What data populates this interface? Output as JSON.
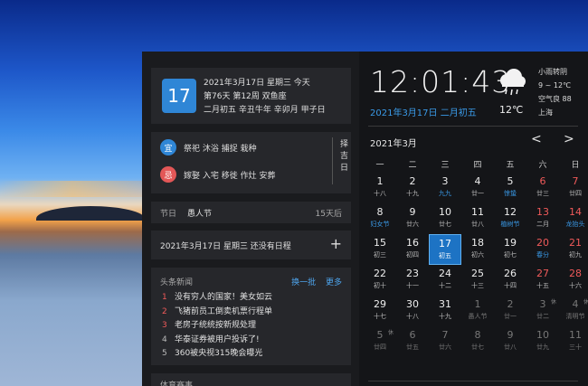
{
  "date_card": {
    "day": "17",
    "line1": "2021年3月17日 星期三 今天",
    "line2": "第76天 第12周 双鱼座",
    "line3": "二月初五 辛丑牛年 辛卯月 甲子日"
  },
  "yiji": {
    "yi_label": "宜",
    "yi_text": "祭祀 沐浴 捕捉 栽种",
    "ji_label": "忌",
    "ji_text": "嫁娶 入宅 移徙 作灶 安葬",
    "zeji_label": "择吉日"
  },
  "festival": {
    "label": "节日",
    "name": "愚人节",
    "days": "15天后"
  },
  "schedule": {
    "text": "2021年3月17日 星期三 还没有日程",
    "add": "+"
  },
  "news": {
    "title": "头条新闻",
    "refresh": "换一批",
    "more": "更多",
    "items": [
      {
        "num": "1",
        "text": "没有穷人的国家！美女如云"
      },
      {
        "num": "2",
        "text": "飞猪前员工倒卖机票行程单"
      },
      {
        "num": "3",
        "text": "老房子统统按新规处理"
      },
      {
        "num": "4",
        "text": "华泰证券被用户投诉了!"
      },
      {
        "num": "5",
        "text": "360被央视315晚会曝光"
      }
    ]
  },
  "sports": {
    "title": "体育赛事"
  },
  "clock": {
    "time": "12:01:43",
    "date": "2021年3月17日 二月初五"
  },
  "weather": {
    "icon": "cloud-rain-icon",
    "temp_now": "12℃",
    "desc": "小雨转阴",
    "range": "9 ~ 12℃",
    "aqi": "空气良 88",
    "city": "上海"
  },
  "calendar": {
    "month": "2021年3月",
    "prev": "<",
    "next": ">",
    "weekdays": [
      "一",
      "二",
      "三",
      "四",
      "五",
      "六",
      "日"
    ],
    "cells": [
      {
        "n": "1",
        "s": "十八"
      },
      {
        "n": "2",
        "s": "十九"
      },
      {
        "n": "3",
        "s": "九九",
        "f": true
      },
      {
        "n": "4",
        "s": "廿一"
      },
      {
        "n": "5",
        "s": "惊蛰",
        "f": true
      },
      {
        "n": "6",
        "s": "廿三",
        "w": true
      },
      {
        "n": "7",
        "s": "廿四",
        "w": true
      },
      {
        "n": "8",
        "s": "妇女节",
        "f": true
      },
      {
        "n": "9",
        "s": "廿六"
      },
      {
        "n": "10",
        "s": "廿七"
      },
      {
        "n": "11",
        "s": "廿八"
      },
      {
        "n": "12",
        "s": "植树节",
        "f": true
      },
      {
        "n": "13",
        "s": "二月",
        "w": true
      },
      {
        "n": "14",
        "s": "龙抬头",
        "w": true,
        "f": true
      },
      {
        "n": "15",
        "s": "初三"
      },
      {
        "n": "16",
        "s": "初四"
      },
      {
        "n": "17",
        "s": "初五",
        "t": true
      },
      {
        "n": "18",
        "s": "初六"
      },
      {
        "n": "19",
        "s": "初七"
      },
      {
        "n": "20",
        "s": "春分",
        "w": true,
        "f": true
      },
      {
        "n": "21",
        "s": "初九",
        "w": true
      },
      {
        "n": "22",
        "s": "初十"
      },
      {
        "n": "23",
        "s": "十一"
      },
      {
        "n": "24",
        "s": "十二"
      },
      {
        "n": "25",
        "s": "十三"
      },
      {
        "n": "26",
        "s": "十四"
      },
      {
        "n": "27",
        "s": "十五",
        "w": true
      },
      {
        "n": "28",
        "s": "十六",
        "w": true
      },
      {
        "n": "29",
        "s": "十七"
      },
      {
        "n": "30",
        "s": "十八"
      },
      {
        "n": "31",
        "s": "十九"
      },
      {
        "n": "1",
        "s": "愚人节",
        "o": true
      },
      {
        "n": "2",
        "s": "廿一",
        "o": true
      },
      {
        "n": "3",
        "s": "廿二",
        "o": true,
        "x": "休"
      },
      {
        "n": "4",
        "s": "清明节",
        "o": true,
        "x": "休"
      },
      {
        "n": "5",
        "s": "廿四",
        "o": true,
        "x": "休"
      },
      {
        "n": "6",
        "s": "廿五",
        "o": true
      },
      {
        "n": "7",
        "s": "廿六",
        "o": true
      },
      {
        "n": "8",
        "s": "廿七",
        "o": true
      },
      {
        "n": "9",
        "s": "廿八",
        "o": true
      },
      {
        "n": "10",
        "s": "廿九",
        "o": true
      },
      {
        "n": "11",
        "s": "三十",
        "o": true
      }
    ]
  },
  "colors": {
    "accent": "#2f86d6",
    "weekend": "#f05a5a",
    "festival": "#3a9ae8"
  }
}
